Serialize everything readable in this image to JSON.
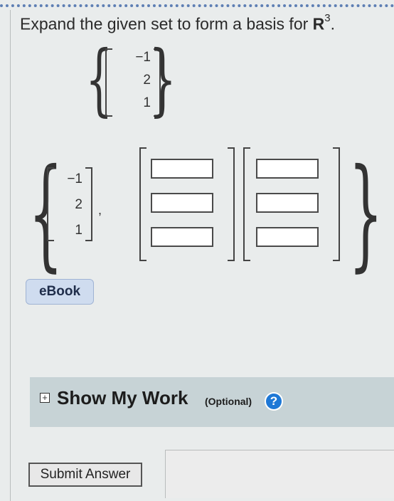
{
  "prompt": {
    "text": "Expand the given set to form a basis for ",
    "space": "R",
    "exponent": "3",
    "period": "."
  },
  "given_set": {
    "vector": [
      "−1",
      "2",
      "1"
    ]
  },
  "answer": {
    "given_vector": [
      "−1",
      "2",
      "1"
    ],
    "comma": ",",
    "vector2_values": [
      "",
      "",
      ""
    ],
    "vector3_values": [
      "",
      "",
      ""
    ]
  },
  "ebook": {
    "label": "eBook"
  },
  "show_my_work": {
    "label": "Show My Work",
    "optional": "(Optional)",
    "expand_symbol": "+",
    "help_symbol": "?"
  },
  "submit": {
    "label": "Submit Answer"
  },
  "colors": {
    "ebook_bg": "#cfdcef",
    "panel_bg": "#c7d3d6",
    "help_blue": "#1e78d6",
    "dotted_border": "#5e7fb4"
  }
}
